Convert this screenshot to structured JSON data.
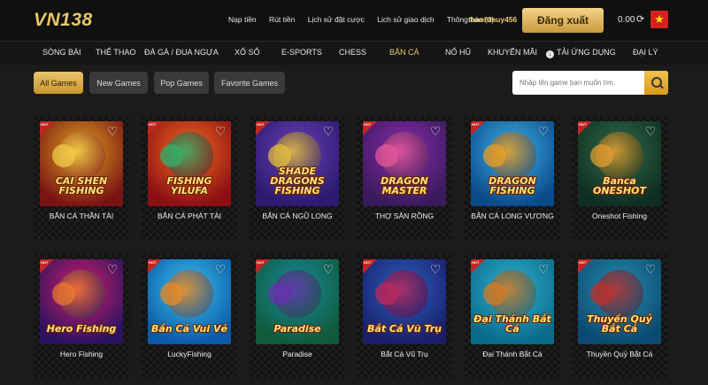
{
  "header": {
    "logo": "VN138",
    "links": [
      "Nạp tiền",
      "Rút tiền",
      "Lịch sử đặt cược",
      "Lịch sử giao dịch",
      "Thông báo (0)"
    ],
    "username": "thanhthuy456",
    "logout_label": "Đăng xuất",
    "balance": "0.00",
    "refresh_icon": "refresh-icon",
    "flag_icon": "vietnam-flag-icon",
    "flag_star": "★"
  },
  "nav": {
    "items": [
      "SÒNG BÀI",
      "THỂ THAO",
      "ĐÁ GÀ / ĐUA NGỰA",
      "XỔ SỐ",
      "E-SPORTS",
      "CHESS",
      "BẮN CÁ",
      "NỔ HŨ",
      "KHUYẾN MÃI",
      "TẢI ỨNG DỤNG",
      "ĐẠI LÝ"
    ],
    "active": "BẮN CÁ",
    "download_icon_glyph": "↓"
  },
  "filters": {
    "buttons": [
      "All Games",
      "New Games",
      "Pop Games",
      "Favorite Games"
    ],
    "active": "All Games"
  },
  "search": {
    "placeholder": "Nhập tên game bạn muốn tìm.",
    "value": ""
  },
  "games": [
    {
      "name": "BẮN CÁ THẦN TÀI",
      "art_title": "CAI SHEN FISHING",
      "hot": true,
      "bg1": "#7a1414",
      "bg2": "#e0a020",
      "accent": "#f3d04a"
    },
    {
      "name": "BẮN CÁ PHÁT TÀI",
      "art_title": "FISHING YILUFA",
      "hot": true,
      "bg1": "#8c0f14",
      "bg2": "#f26b1d",
      "accent": "#2fb36b"
    },
    {
      "name": "BẮN CÁ NGŨ LONG",
      "art_title": "SHADE DRAGONS FISHING",
      "hot": true,
      "bg1": "#2b1a6e",
      "bg2": "#6a3fb8",
      "accent": "#e8c23a"
    },
    {
      "name": "THỢ SĂN RỒNG",
      "art_title": "DRAGON MASTER",
      "hot": true,
      "bg1": "#3a1a5c",
      "bg2": "#8a2bb0",
      "accent": "#e85a9a"
    },
    {
      "name": "BẮN CÁ LONG VƯƠNG",
      "art_title": "DRAGON FISHING",
      "hot": true,
      "bg1": "#0c4a8a",
      "bg2": "#3ab0e6",
      "accent": "#f0a020"
    },
    {
      "name": "Oneshot Fishing",
      "art_title": "Banca ONESHOT",
      "hot": true,
      "bg1": "#0f2e22",
      "bg2": "#2f6b4a",
      "accent": "#e8a030"
    },
    {
      "name": "Hero Fishing",
      "art_title": "Hero Fishing",
      "hot": true,
      "bg1": "#2a1260",
      "bg2": "#d0206a",
      "accent": "#f07a30"
    },
    {
      "name": "LuckyFishing",
      "art_title": "Bắn Cá Vui Vẻ",
      "hot": true,
      "bg1": "#0a5aa6",
      "bg2": "#3cc0ee",
      "accent": "#f08a20"
    },
    {
      "name": "Paradise",
      "art_title": "Paradise",
      "hot": true,
      "bg1": "#0f5a3a",
      "bg2": "#1a8aa0",
      "accent": "#6a30b0"
    },
    {
      "name": "Bắt Cá Vũ Trụ",
      "art_title": "Bắt Cá Vũ Trụ",
      "hot": true,
      "bg1": "#1a1e6a",
      "bg2": "#2a60c0",
      "accent": "#c02a5a"
    },
    {
      "name": "Đại Thánh Bắt Cá",
      "art_title": "Đại Thánh Bắt Cá",
      "hot": true,
      "bg1": "#0a6a8a",
      "bg2": "#30b0d0",
      "accent": "#d87a20"
    },
    {
      "name": "Thuyền Quỷ Bắt Cá",
      "art_title": "Thuyền Quỷ Bắt Cá",
      "hot": true,
      "bg1": "#0a4a70",
      "bg2": "#2a8ab0",
      "accent": "#c0302a"
    }
  ],
  "card_badge": "HOT",
  "heart_glyph": "♡"
}
